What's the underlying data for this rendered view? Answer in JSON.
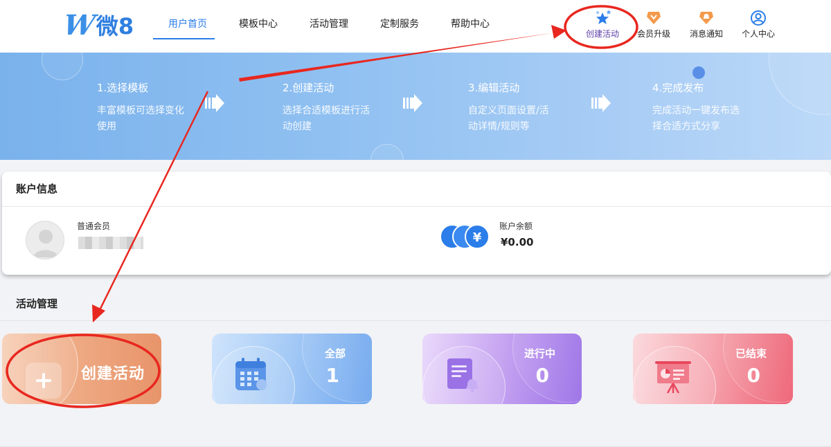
{
  "header": {
    "logo": {
      "mark": "W",
      "text": "微8"
    },
    "nav": [
      {
        "label": "用户首页",
        "active": true
      },
      {
        "label": "模板中心",
        "active": false
      },
      {
        "label": "活动管理",
        "active": false
      },
      {
        "label": "定制服务",
        "active": false
      },
      {
        "label": "帮助中心",
        "active": false
      }
    ],
    "tools": [
      {
        "label": "创建活动",
        "icon": "stars-icon"
      },
      {
        "label": "会员升级",
        "icon": "diamond-badge-icon"
      },
      {
        "label": "消息通知",
        "icon": "bell-badge-icon"
      },
      {
        "label": "个人中心",
        "icon": "user-icon"
      }
    ]
  },
  "banner": {
    "steps": [
      {
        "title": "1.选择模板",
        "desc": "丰富模板可选择变化使用"
      },
      {
        "title": "2.创建活动",
        "desc": "选择合适模板进行活动创建"
      },
      {
        "title": "3.编辑活动",
        "desc": "自定义页面设置/活动详情/规则等"
      },
      {
        "title": "4.完成发布",
        "desc": "完成活动一键发布选择合适方式分享"
      }
    ]
  },
  "account": {
    "title": "账户信息",
    "member_level": "普通会员",
    "balance_label": "账户余额",
    "balance_value": "¥0.00",
    "coin_symbol": "¥"
  },
  "activity": {
    "title": "活动管理",
    "create_label": "创建活动",
    "cards": [
      {
        "label": "全部",
        "count": "1",
        "icon": "calendar-icon"
      },
      {
        "label": "进行中",
        "count": "0",
        "icon": "document-bell-icon"
      },
      {
        "label": "已结束",
        "count": "0",
        "icon": "presentation-board-icon"
      }
    ]
  },
  "colors": {
    "primary_blue": "#2b7de9",
    "annotation_red": "#e8271f",
    "create_orange": "#e8946a",
    "all_blue": "#6fa6ee",
    "ongoing_purple": "#9a6ee6",
    "ended_red": "#ee5f72"
  }
}
